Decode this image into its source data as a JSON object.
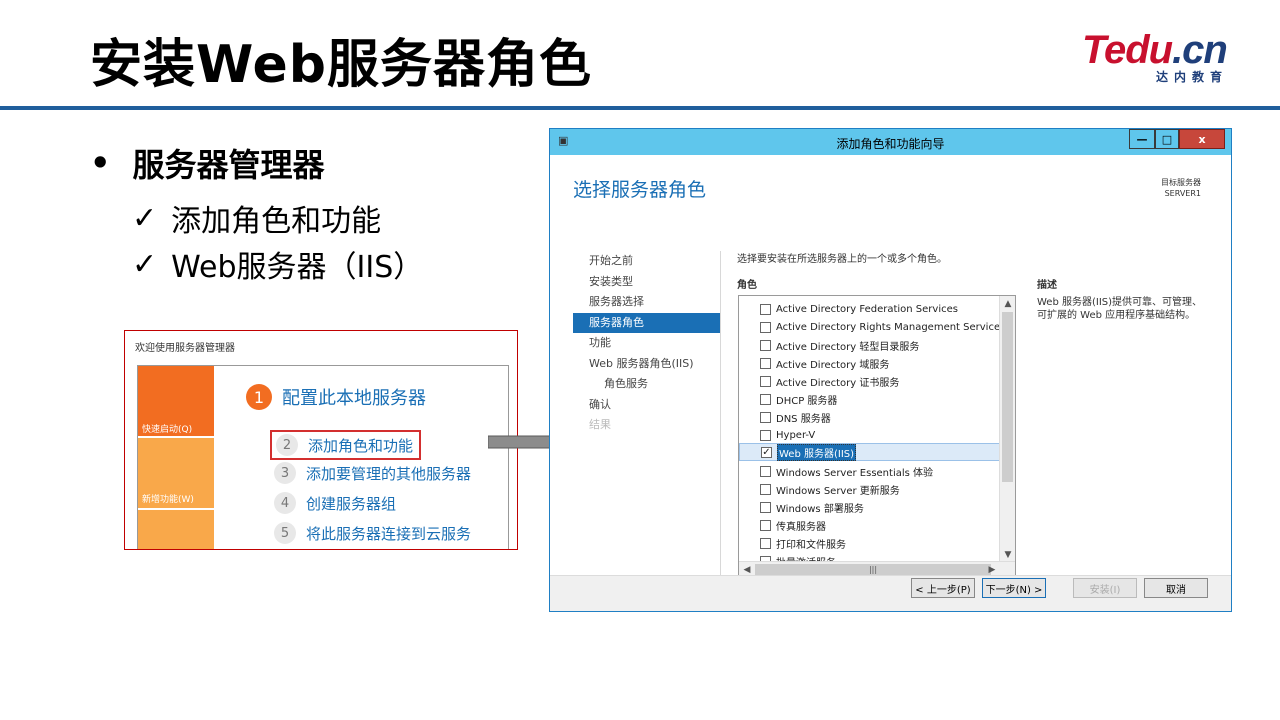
{
  "slide": {
    "title": "安装Web服务器角色",
    "logo_main_a": "Tedu",
    "logo_main_b": ".cn",
    "logo_sub": "达内教育",
    "bullet": "服务器管理器",
    "bullet_marker": "•",
    "check_mark": "✓",
    "sub_items": [
      "添加角色和功能",
      "Web服务器（IIS）"
    ]
  },
  "server_manager": {
    "title": "欢迎使用服务器管理器",
    "quick_start": "快速启动(Q)",
    "new_features": "新增功能(W)",
    "steps": [
      {
        "num": "1",
        "label": "配置此本地服务器"
      },
      {
        "num": "2",
        "label": "添加角色和功能"
      },
      {
        "num": "3",
        "label": "添加要管理的其他服务器"
      },
      {
        "num": "4",
        "label": "创建服务器组"
      },
      {
        "num": "5",
        "label": "将此服务器连接到云服务"
      }
    ]
  },
  "wizard": {
    "window_title": "添加角色和功能向导",
    "controls": {
      "minimize": "—",
      "maximize": "□",
      "close": "x"
    },
    "heading": "选择服务器角色",
    "dest_label": "目标服务器",
    "dest_server": "SERVER1",
    "nav": [
      {
        "label": "开始之前",
        "state": "normal",
        "indent": false
      },
      {
        "label": "安装类型",
        "state": "normal",
        "indent": false
      },
      {
        "label": "服务器选择",
        "state": "normal",
        "indent": false
      },
      {
        "label": "服务器角色",
        "state": "selected",
        "indent": false
      },
      {
        "label": "功能",
        "state": "normal",
        "indent": false
      },
      {
        "label": "Web 服务器角色(IIS)",
        "state": "normal",
        "indent": false
      },
      {
        "label": "角色服务",
        "state": "normal",
        "indent": true
      },
      {
        "label": "确认",
        "state": "normal",
        "indent": false
      },
      {
        "label": "结果",
        "state": "disabled",
        "indent": false
      }
    ],
    "intro": "选择要安装在所选服务器上的一个或多个角色。",
    "roles_header": "角色",
    "description_header": "描述",
    "description_text": "Web 服务器(IIS)提供可靠、可管理、可扩展的 Web 应用程序基础结构。",
    "roles": [
      {
        "label": "Active Directory Federation Services",
        "checked": false,
        "selected": false
      },
      {
        "label": "Active Directory Rights Management Services",
        "checked": false,
        "selected": false
      },
      {
        "label": "Active Directory 轻型目录服务",
        "checked": false,
        "selected": false
      },
      {
        "label": "Active Directory 域服务",
        "checked": false,
        "selected": false
      },
      {
        "label": "Active Directory 证书服务",
        "checked": false,
        "selected": false
      },
      {
        "label": "DHCP 服务器",
        "checked": false,
        "selected": false
      },
      {
        "label": "DNS 服务器",
        "checked": false,
        "selected": false
      },
      {
        "label": "Hyper-V",
        "checked": false,
        "selected": false
      },
      {
        "label": "Web 服务器(IIS)",
        "checked": true,
        "selected": true
      },
      {
        "label": "Windows Server Essentials 体验",
        "checked": false,
        "selected": false
      },
      {
        "label": "Windows Server 更新服务",
        "checked": false,
        "selected": false
      },
      {
        "label": "Windows 部署服务",
        "checked": false,
        "selected": false
      },
      {
        "label": "传真服务器",
        "checked": false,
        "selected": false
      },
      {
        "label": "打印和文件服务",
        "checked": false,
        "selected": false
      },
      {
        "label": "批量激活服务",
        "checked": false,
        "selected": false
      }
    ],
    "buttons": {
      "back": "< 上一步(P)",
      "next": "下一步(N) >",
      "install": "安装(I)",
      "cancel": "取消"
    }
  },
  "colors": {
    "accent": "#1a6fb5",
    "titlebar": "#5fc6ec",
    "header_rule": "#1f5e9c",
    "highlight_red": "#d32f2f",
    "orange": "#f26d21"
  }
}
